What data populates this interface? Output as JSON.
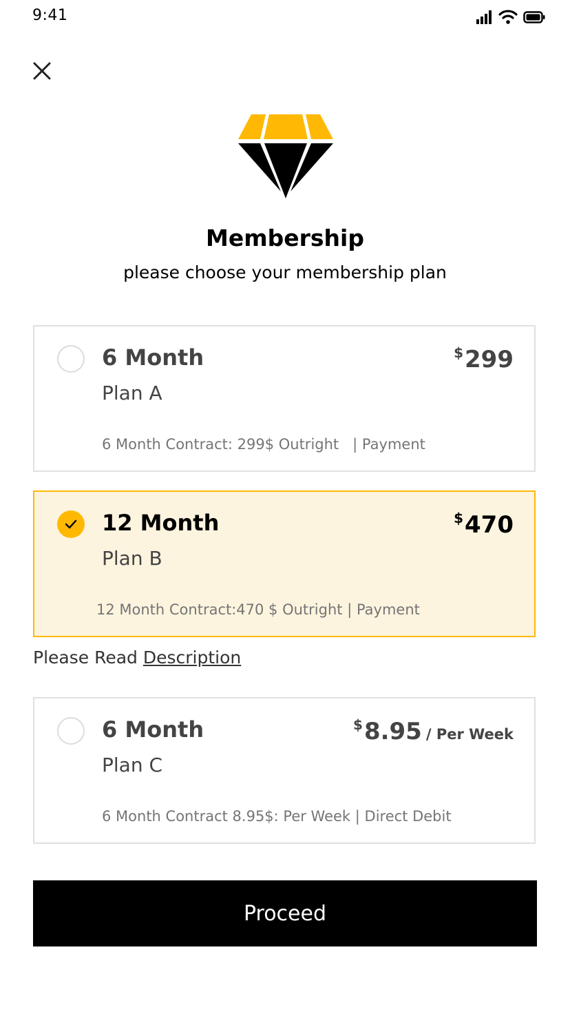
{
  "status_bar": {
    "time": "9:41"
  },
  "header": {
    "title": "Membership",
    "subtitle": "please choose your membership plan"
  },
  "plans": [
    {
      "term": "6 Month",
      "name": "Plan A",
      "currency": "$",
      "price": "299",
      "period": "",
      "description": "6 Month Contract: 299$ Outright   | Payment",
      "selected": false
    },
    {
      "term": "12 Month",
      "name": "Plan B",
      "currency": "$",
      "price": "470",
      "period": "",
      "description": "12 Month Contract:470 $ Outright | Payment",
      "selected": true
    },
    {
      "term": "6 Month",
      "name": "Plan C",
      "currency": "$",
      "price": "8.95",
      "period": "/ Per Week",
      "description": "6 Month Contract 8.95$: Per Week | Direct Debit",
      "selected": false
    }
  ],
  "read_note": {
    "prefix": "Please Read ",
    "link": "Description"
  },
  "proceed_label": "Proceed",
  "colors": {
    "accent": "#ffb904",
    "selected_bg": "#fdf4df",
    "button_bg": "#000000",
    "border": "#e0e0e0"
  },
  "icons": [
    "cellular-signal-icon",
    "wifi-icon",
    "battery-icon",
    "close-icon",
    "diamond-logo-icon",
    "checkmark-icon"
  ]
}
